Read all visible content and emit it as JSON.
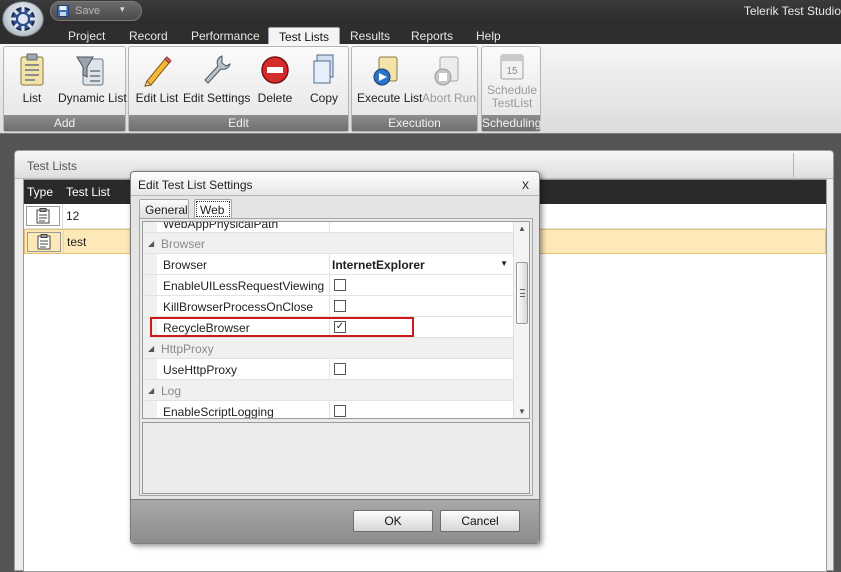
{
  "app": {
    "title": "Telerik Test Studio",
    "save_label": "Save"
  },
  "ribbon_tabs": [
    "Project",
    "Record",
    "Performance",
    "Test Lists",
    "Results",
    "Reports",
    "Help"
  ],
  "active_tab": "Test Lists",
  "ribbon_groups": {
    "add": {
      "label": "Add",
      "buttons": [
        "List",
        "Dynamic List"
      ]
    },
    "edit": {
      "label": "Edit",
      "buttons": [
        "Edit List",
        "Edit Settings",
        "Delete",
        "Copy"
      ]
    },
    "execution": {
      "label": "Execution",
      "buttons": [
        "Execute List",
        "Abort Run"
      ]
    },
    "scheduling": {
      "label": "Scheduling",
      "buttons": [
        "Schedule",
        "TestList"
      ]
    }
  },
  "main": {
    "panel_title": "Test Lists",
    "columns": [
      "Type",
      "Test List"
    ],
    "rows": [
      "12",
      "test"
    ],
    "selected_row": "test"
  },
  "dialog": {
    "title": "Edit Test List Settings",
    "close_glyph": "x",
    "tabs": [
      "General",
      "Web"
    ],
    "active_tab": "Web",
    "properties": {
      "partial_top": "WebAppPhysicalPath",
      "cat_browser": "Browser",
      "browser_label": "Browser",
      "browser_value": "InternetExplorer",
      "enable_ui_less": "EnableUILessRequestViewing",
      "kill_browser": "KillBrowserProcessOnClose",
      "recycle_browser": "RecycleBrowser",
      "cat_http_proxy": "HttpProxy",
      "use_http_proxy": "UseHttpProxy",
      "cat_log": "Log",
      "enable_script_logging": "EnableScriptLogging"
    },
    "checks": {
      "enable_ui_less": false,
      "kill_browser": false,
      "recycle_browser": true,
      "use_http_proxy": false,
      "enable_script_logging": false
    },
    "ok_label": "OK",
    "cancel_label": "Cancel",
    "highlight_color": "#d01818"
  }
}
